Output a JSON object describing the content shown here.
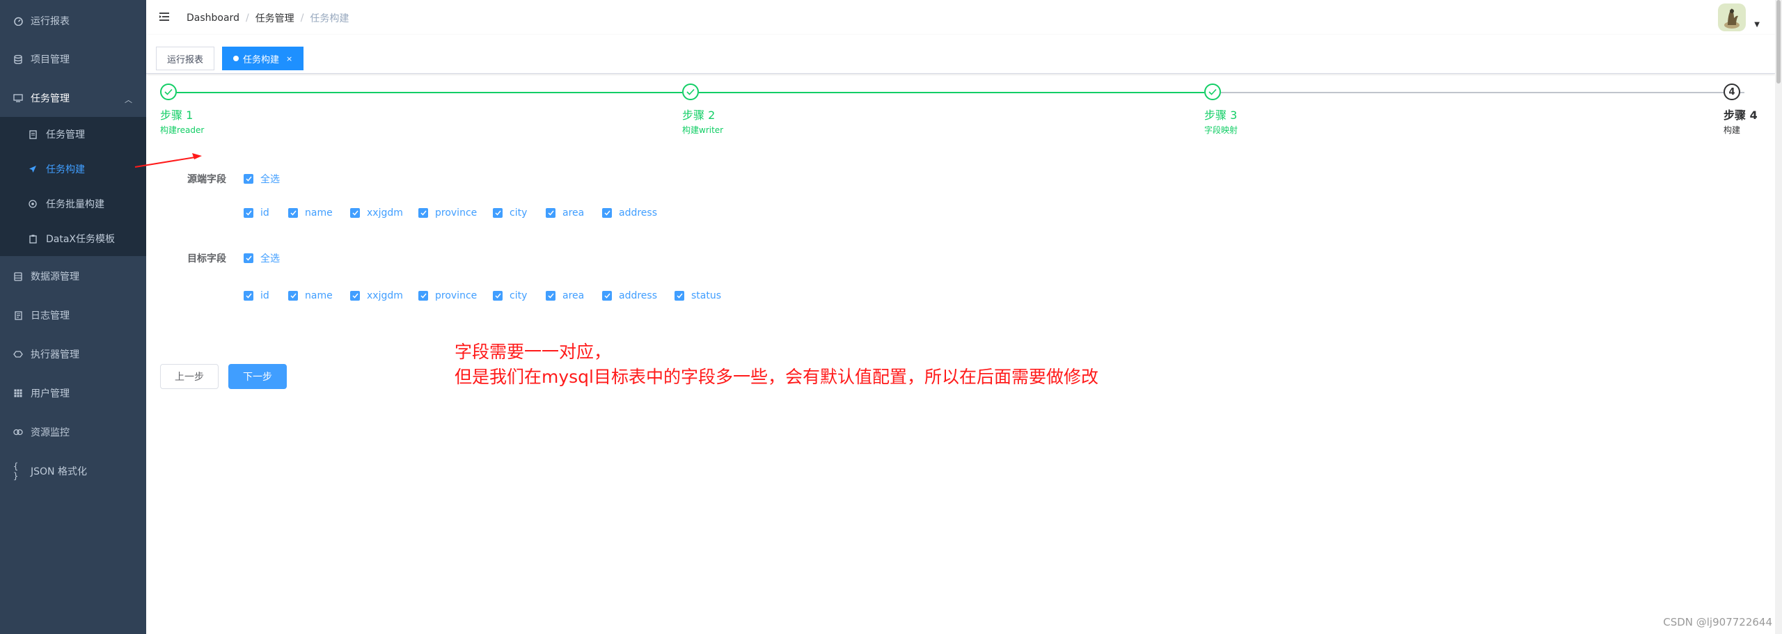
{
  "sidebar": {
    "items": [
      {
        "label": "运行报表",
        "icon": "dashboard-icon"
      },
      {
        "label": "项目管理",
        "icon": "database-icon"
      },
      {
        "label": "任务管理",
        "icon": "monitor-icon",
        "expanded": true
      },
      {
        "label": "数据源管理",
        "icon": "datasource-icon"
      },
      {
        "label": "日志管理",
        "icon": "log-icon"
      },
      {
        "label": "执行器管理",
        "icon": "executor-icon"
      },
      {
        "label": "用户管理",
        "icon": "user-grid-icon"
      },
      {
        "label": "资源监控",
        "icon": "monitor-link-icon"
      },
      {
        "label": "JSON 格式化",
        "icon": "json-braces-icon"
      }
    ],
    "subitems": [
      {
        "label": "任务管理",
        "icon": "task-doc-icon",
        "active": false
      },
      {
        "label": "任务构建",
        "icon": "send-icon",
        "active": true
      },
      {
        "label": "任务批量构建",
        "icon": "batch-icon",
        "active": false
      },
      {
        "label": "DataX任务模板",
        "icon": "template-icon",
        "active": false
      }
    ]
  },
  "navbar": {
    "breadcrumb": [
      "Dashboard",
      "任务管理",
      "任务构建"
    ],
    "separator": "/"
  },
  "tags": [
    {
      "label": "运行报表",
      "active": false
    },
    {
      "label": "任务构建",
      "active": true,
      "close": "×"
    }
  ],
  "steps": [
    {
      "title": "步骤 1",
      "desc": "构建reader",
      "status": "finished"
    },
    {
      "title": "步骤 2",
      "desc": "构建writer",
      "status": "finished"
    },
    {
      "title": "步骤 3",
      "desc": "字段映射",
      "status": "finished"
    },
    {
      "title": "步骤 4",
      "desc": "构建",
      "status": "current",
      "number": "4"
    }
  ],
  "form": {
    "source_label": "源端字段",
    "target_label": "目标字段",
    "select_all": "全选",
    "source_fields": [
      "id",
      "name",
      "xxjgdm",
      "province",
      "city",
      "area",
      "address"
    ],
    "target_fields": [
      "id",
      "name",
      "xxjgdm",
      "province",
      "city",
      "area",
      "address",
      "status"
    ]
  },
  "buttons": {
    "prev": "上一步",
    "next": "下一步"
  },
  "annotation": {
    "line1": "字段需要一一对应，",
    "line2": "但是我们在mysql目标表中的字段多一些，会有默认值配置，所以在后面需要做修改"
  },
  "watermark": "CSDN @lj907722644",
  "colors": {
    "sidebar_bg": "#304156",
    "submenu_bg": "#1f2d3d",
    "active_blue": "#409eff",
    "tag_active": "#1e90ff",
    "step_green": "#13ce66",
    "annotation_red": "#ff1a1a"
  }
}
